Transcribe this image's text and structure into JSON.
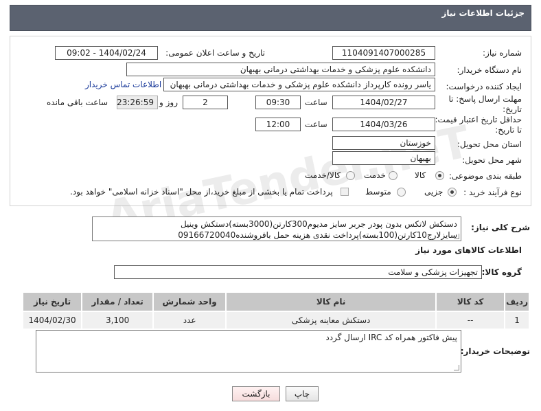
{
  "header": {
    "title": "جزئیات اطلاعات نیاز"
  },
  "form": {
    "need_number_label": "شماره نیاز:",
    "need_number": "1104091407000285",
    "announce_label": "تاریخ و ساعت اعلان عمومی:",
    "announce_value": "1404/02/24 - 09:02",
    "buyer_org_label": "نام دستگاه خریدار:",
    "buyer_org": "دانشکده علوم پزشکی و خدمات بهداشتی  درمانی بهبهان",
    "requester_label": "ایجاد کننده درخواست:",
    "requester": "یاسر رونده کارپرداز دانشکده علوم پزشکی و خدمات بهداشتی  درمانی بهبهان",
    "contact_link": "اطلاعات تماس خریدار",
    "reply_deadline_label_1": "مهلت ارسال پاسخ: تا",
    "reply_deadline_label_2": "تاریخ:",
    "reply_date": "1404/02/27",
    "time_label": "ساعت",
    "reply_time": "09:30",
    "days_value": "2",
    "days_label": "روز و",
    "remaining_value": "23:26:59",
    "remaining_label": "ساعت باقی مانده",
    "price_validity_label_1": "حداقل تاریخ اعتبار قیمت:",
    "price_validity_label_2": "تا تاریخ:",
    "validity_date": "1404/03/26",
    "validity_time": "12:00",
    "province_label": "استان محل تحویل:",
    "province": "خوزستان",
    "city_label": "شهر محل تحویل:",
    "city": "بهبهان",
    "category_label": "طبقه بندی موضوعی:",
    "category_options": [
      "کالا",
      "خدمت",
      "کالا/خدمت"
    ],
    "category_selected": 0,
    "process_label": "نوع فرآیند خرید :",
    "process_options": [
      "جزیی",
      "متوسط"
    ],
    "process_selected": 0,
    "payment_note": "پرداخت تمام یا بخشی از مبلغ خرید،از محل \"اسناد خزانه اسلامی\" خواهد بود."
  },
  "description": {
    "label": "شرح کلی نیاز:",
    "line1": "دستکش لاتکس بدون پودر جربر سایز مدیوم300کارتن(3000بسته)دستکش وینیل",
    "line2": "سایزلارج10کارتن(100بسته)پرداخت نقدی هزینه حمل بافروشنده09166720040"
  },
  "goods": {
    "section_title": "اطلاعات کالاهای مورد نیاز",
    "group_label": "گروه کالا:",
    "group_value": "تجهیزات پزشکی و سلامت",
    "columns": [
      "ردیف",
      "کد کالا",
      "نام کالا",
      "واحد شمارش",
      "تعداد / مقدار",
      "تاریخ نیاز"
    ],
    "rows": [
      [
        "1",
        "--",
        "دستکش معاینه پزشکی",
        "عدد",
        "3,100",
        "1404/02/30"
      ]
    ]
  },
  "buyer_notes": {
    "label": "توضیحات خریدار:",
    "text": "پیش فاکتور همراه کد IRC ارسال گردد"
  },
  "buttons": {
    "print": "چاپ",
    "back": "بازگشت"
  },
  "watermark": "AriaTender.neT"
}
